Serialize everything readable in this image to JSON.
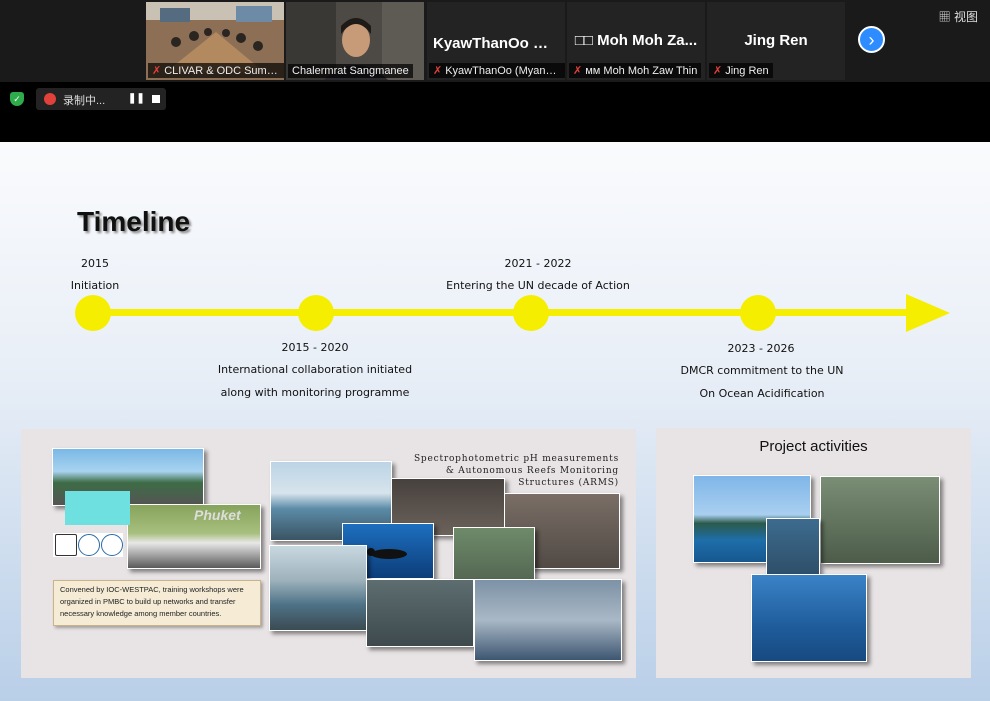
{
  "meeting": {
    "participants": [
      {
        "caption": "CLIVAR & ODC Summ...",
        "muted": true,
        "video": "conference-room"
      },
      {
        "caption": "Chalermrat Sangmanee",
        "muted": false,
        "video": "person",
        "active": true
      },
      {
        "display_name": "KyawThanOo （...",
        "caption": "KyawThanOo (Myanm...",
        "muted": true
      },
      {
        "display_name": "□□ Moh Moh Za...",
        "caption": "ᴍᴍ Moh Moh Zaw Thin",
        "muted": true
      },
      {
        "display_name": "Jing Ren",
        "caption": "Jing Ren",
        "muted": true
      }
    ],
    "next_icon": "›",
    "view_label": "视图",
    "recording_label": "录制中...",
    "pause_icon": "❚❚"
  },
  "slide": {
    "title": "Timeline",
    "timeline": [
      {
        "year": "2015",
        "text": "Initiation"
      },
      {
        "year": "2015 - 2020",
        "text1": "International collaboration initiated",
        "text2": "along with monitoring programme"
      },
      {
        "year": "2021 - 2022",
        "text": "Entering the UN decade of Action"
      },
      {
        "year": "2023 - 2026",
        "text1": "DMCR commitment to the UN",
        "text2": "On Ocean Acidification"
      }
    ],
    "left_panel": {
      "spec_line1": "Spectrophotometric pH measurements",
      "spec_line2": "& Autonomous Reefs Monitoring",
      "spec_line3": "Structures (ARMS)",
      "note": "Convened by IOC-WESTPAC, training workshops were organized in PMBC to build up networks and transfer necessary knowledge among member countries.",
      "banner_text": "Phuket"
    },
    "right_panel": {
      "title": "Project activities"
    }
  },
  "colors": {
    "timeline_yellow": "#f5ee00",
    "zoom_blue": "#2d8cff",
    "mute_red": "#e0413a"
  }
}
